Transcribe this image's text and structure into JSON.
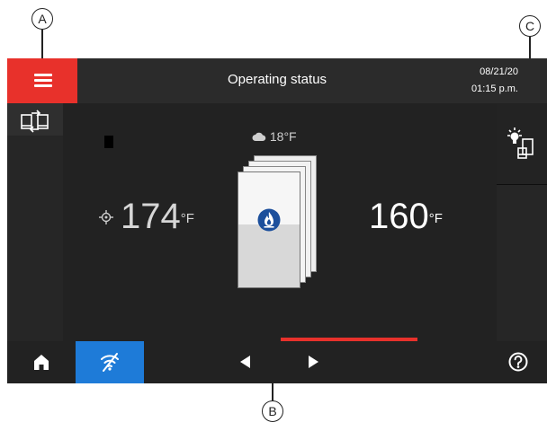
{
  "callouts": {
    "a": "A",
    "b": "B",
    "c": "C"
  },
  "header": {
    "title": "Operating status",
    "date": "08/21/20",
    "time": "01:15 p.m."
  },
  "main": {
    "outdoor_temp": "18°F",
    "setpoint_temp_value": "174",
    "setpoint_temp_unit": "°F",
    "actual_temp_value": "160",
    "actual_temp_unit": "°F"
  },
  "colors": {
    "accent_red": "#e8312b",
    "accent_blue": "#1e7bd8",
    "flame_blue": "#1c4f9c"
  },
  "icons": {
    "menu": "hamburger-menu-icon",
    "switch_unit": "switch-device-icon",
    "cloud": "cloud-icon",
    "setpoint": "crosshair-icon",
    "flame": "gas-flame-icon",
    "lighting": "lighting-device-icon",
    "home": "home-icon",
    "wifi_off": "wifi-off-icon",
    "prev": "triangle-left-icon",
    "next": "triangle-right-icon",
    "help": "help-icon"
  }
}
